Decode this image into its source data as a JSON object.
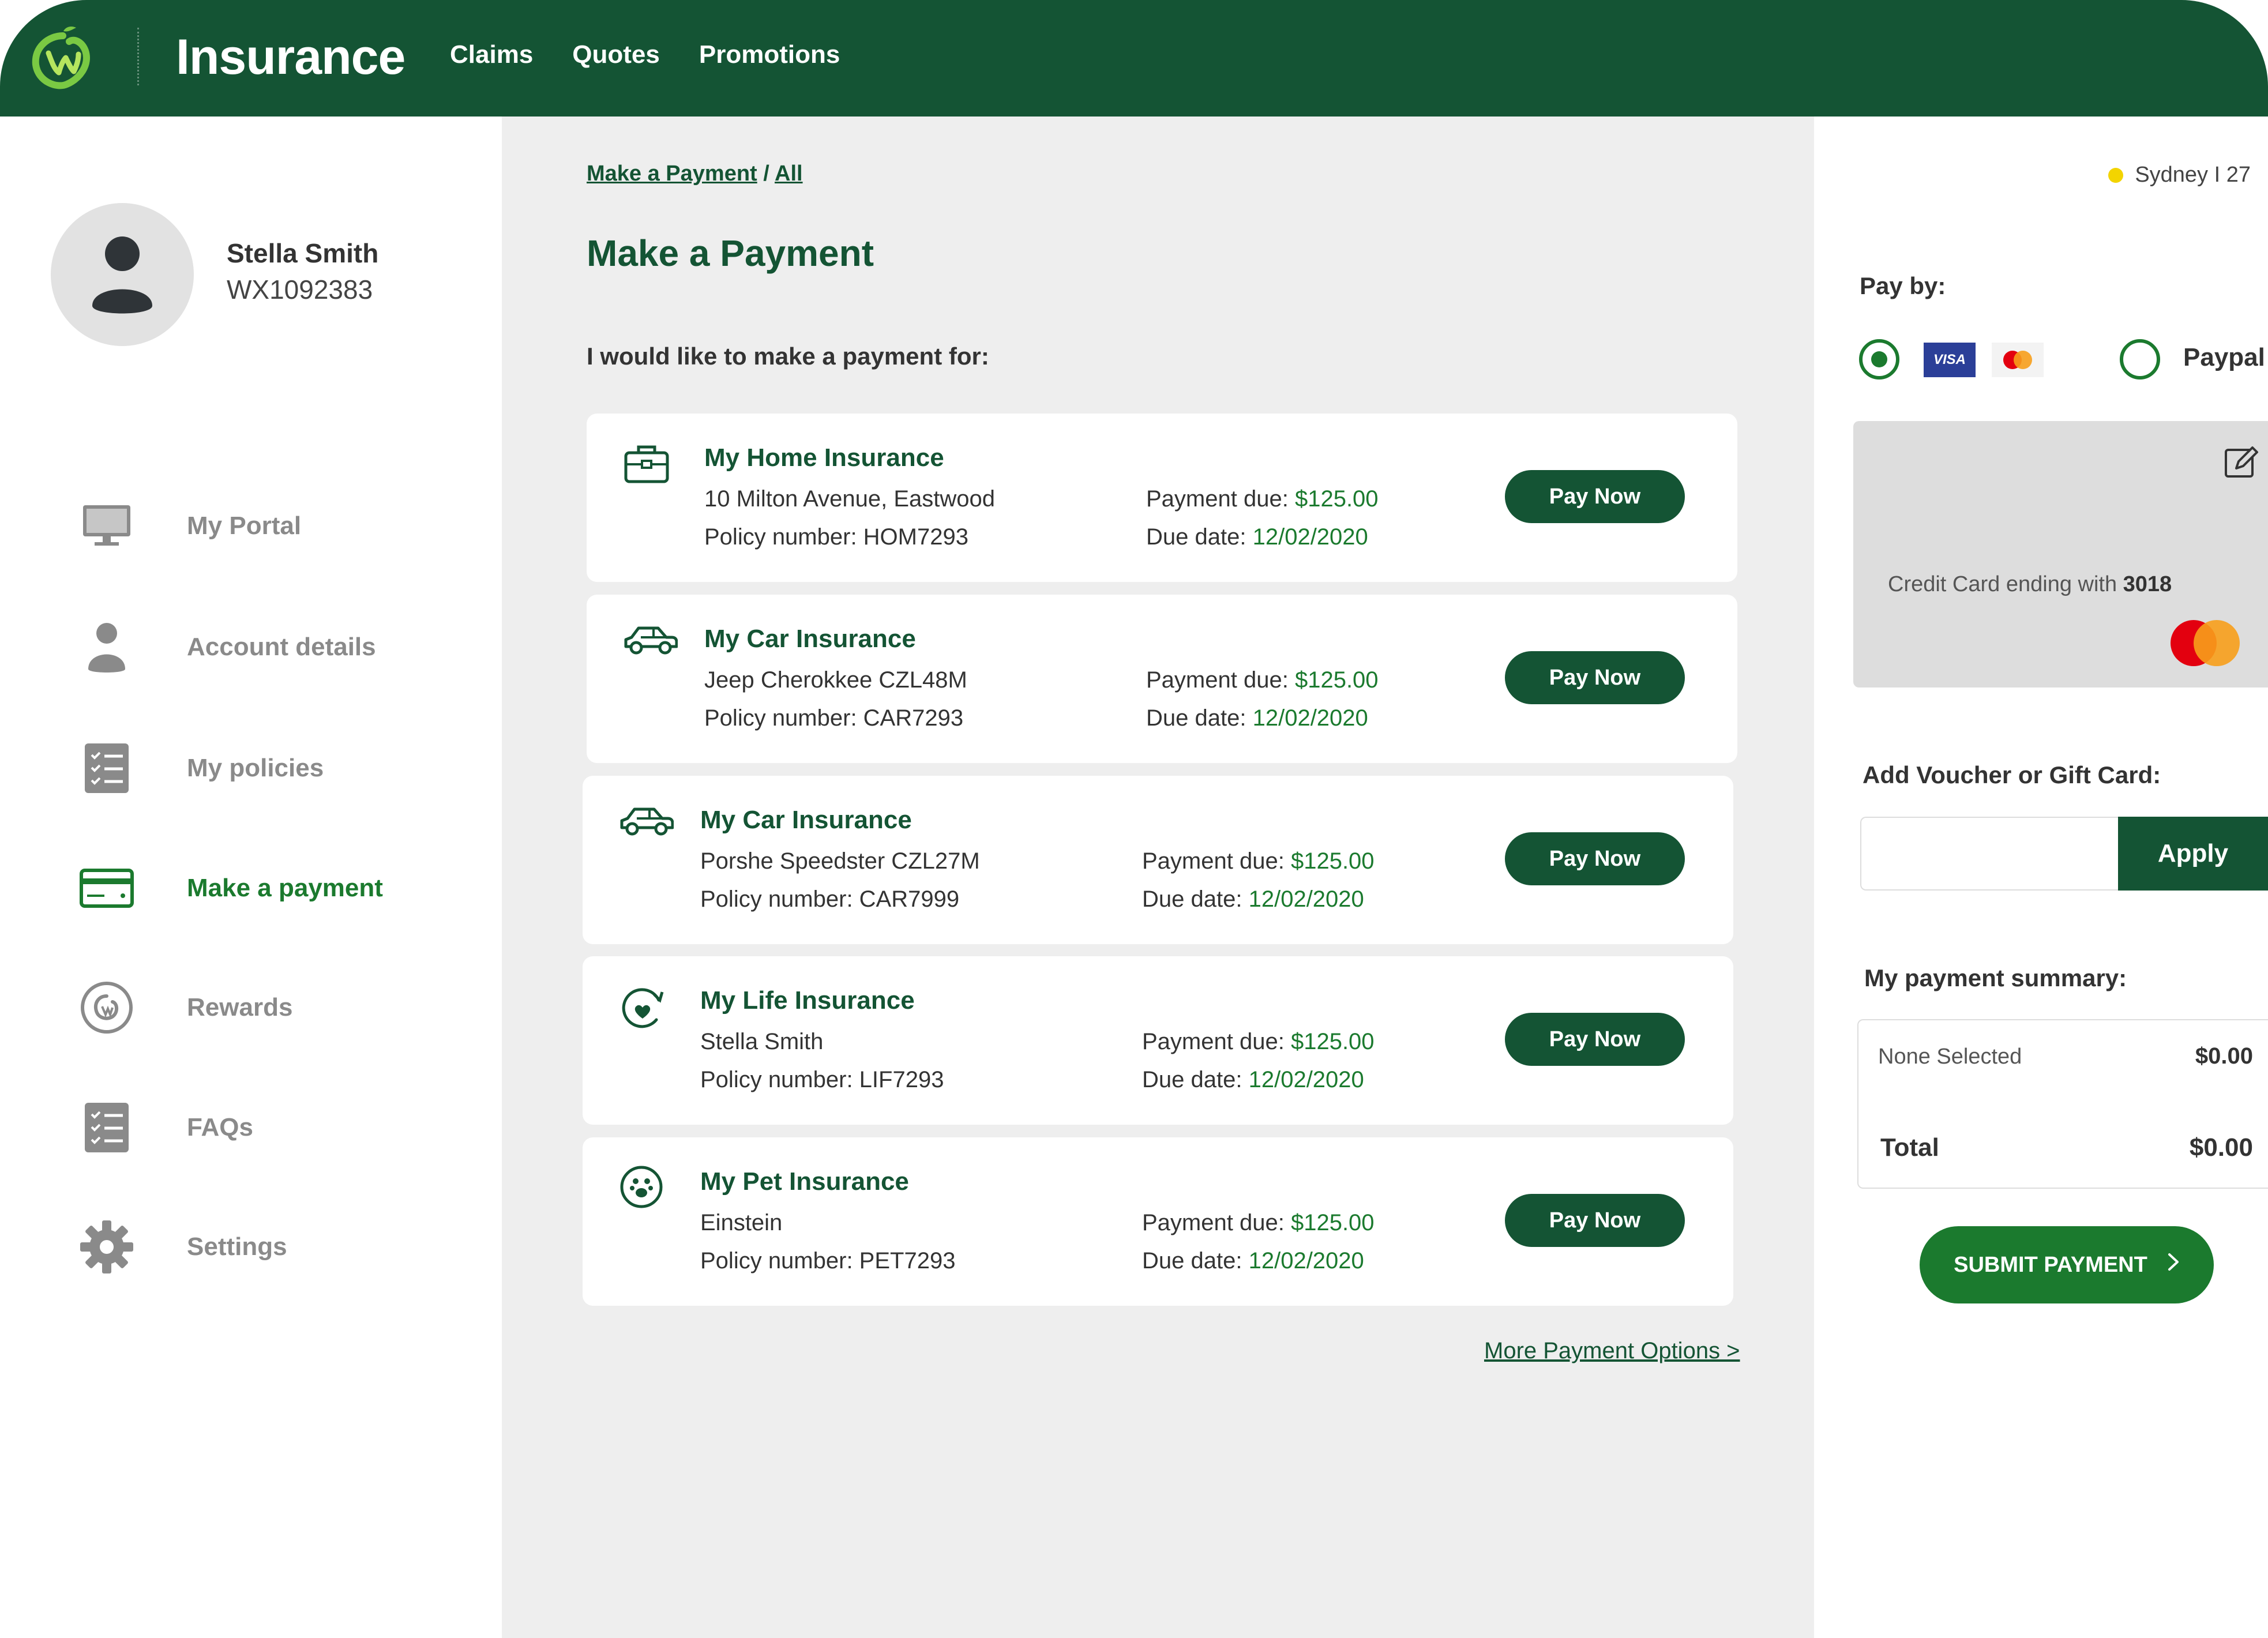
{
  "header": {
    "brand": "Insurance",
    "nav": [
      {
        "label": "Claims"
      },
      {
        "label": "Quotes"
      },
      {
        "label": "Promotions"
      }
    ]
  },
  "user": {
    "name": "Stella Smith",
    "id": "WX1092383"
  },
  "sidebar": {
    "items": [
      {
        "label": "My Portal",
        "icon": "monitor-icon"
      },
      {
        "label": "Account details",
        "icon": "person-icon"
      },
      {
        "label": "My policies",
        "icon": "checklist-icon"
      },
      {
        "label": "Make a payment",
        "icon": "credit-card-icon",
        "active": true
      },
      {
        "label": "Rewards",
        "icon": "rewards-icon"
      },
      {
        "label": "FAQs",
        "icon": "checklist-icon"
      },
      {
        "label": "Settings",
        "icon": "gear-icon"
      }
    ]
  },
  "main": {
    "breadcrumb": {
      "first": "Make a Payment",
      "separator": "/",
      "second": "All"
    },
    "title": "Make a Payment",
    "intro": "I would like to make a payment for:",
    "payment_due_label": "Payment due:",
    "due_date_label": "Due date:",
    "pay_label": "Pay Now",
    "policies": [
      {
        "title": "My Home Insurance",
        "detail": "10 Milton Avenue, Eastwood",
        "policy": "Policy number: HOM7293",
        "amount": "$125.00",
        "date": "12/02/2020",
        "icon": "briefcase-icon"
      },
      {
        "title": "My Car Insurance",
        "detail": "Jeep Cherokkee CZL48M",
        "policy": "Policy number: CAR7293",
        "amount": "$125.00",
        "date": "12/02/2020",
        "icon": "car-icon"
      },
      {
        "title": "My Car Insurance",
        "detail": "Porshe Speedster CZL27M",
        "policy": "Policy number: CAR7999",
        "amount": "$125.00",
        "date": "12/02/2020",
        "icon": "car-icon"
      },
      {
        "title": "My Life Insurance",
        "detail": "Stella Smith",
        "policy": "Policy number: LIF7293",
        "amount": "$125.00",
        "date": "12/02/2020",
        "icon": "heart-cycle-icon"
      },
      {
        "title": "My Pet Insurance",
        "detail": "Einstein",
        "policy": "Policy number: PET7293",
        "amount": "$125.00",
        "date": "12/02/2020",
        "icon": "paw-icon"
      }
    ],
    "more_options": "More Payment Options >"
  },
  "right": {
    "location": "Sydney I 27",
    "pay_by": "Pay by:",
    "visa_text": "VISA",
    "paypal": "Paypal",
    "card_prefix": "Credit Card ending with ",
    "card_last4": "3018",
    "voucher_label": "Add Voucher or Gift Card:",
    "voucher_value": "",
    "apply": "Apply",
    "summary_label": "My payment summary:",
    "summary_item": "None Selected",
    "summary_item_amount": "$0.00",
    "total_label": "Total",
    "total_amount": "$0.00",
    "submit": "SUBMIT PAYMENT"
  },
  "colors": {
    "brand_dark_green": "#145434",
    "accent_green": "#1b7a2e",
    "panel_grey": "#eeeeee",
    "status_yellow": "#f3d400"
  }
}
